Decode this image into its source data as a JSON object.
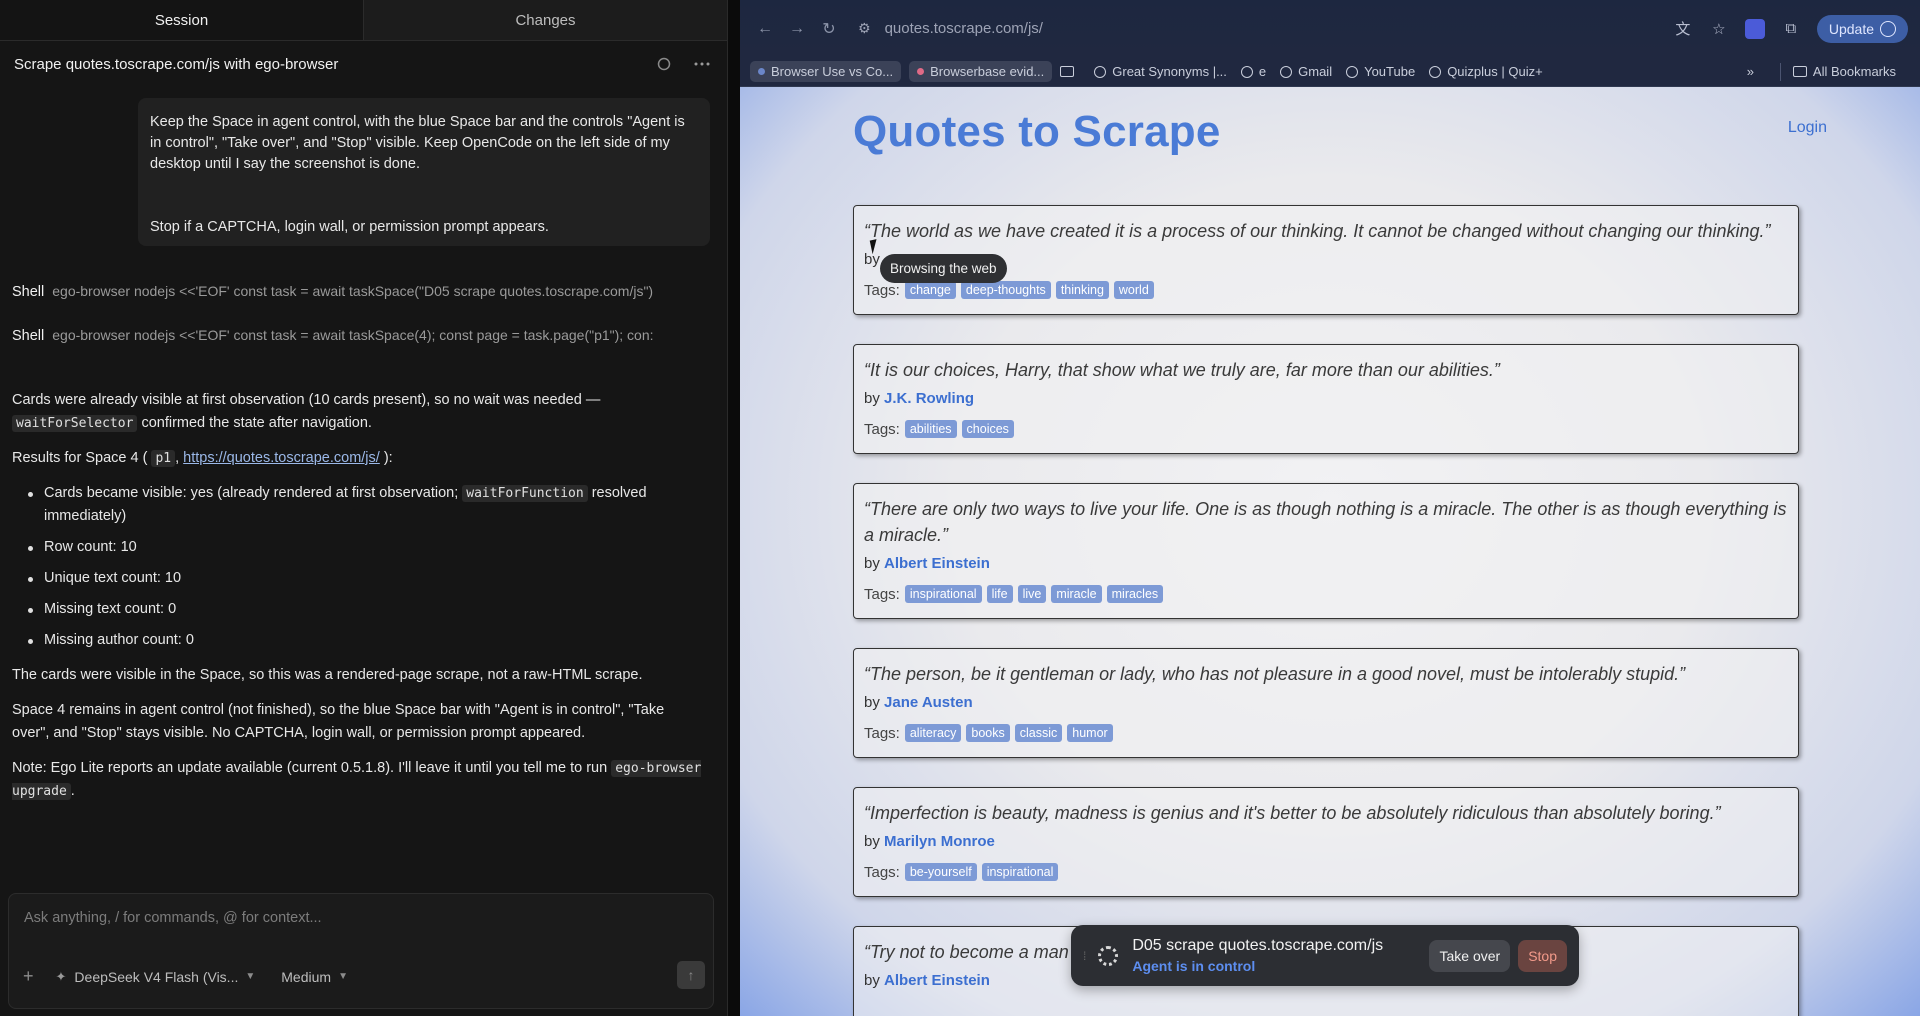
{
  "session_panel": {
    "tabs": {
      "session": "Session",
      "changes": "Changes"
    },
    "session_title": "Scrape quotes.toscrape.com/js with ego-browser",
    "user_message": {
      "paragraph1": "Keep the Space in agent control, with the blue Space bar and the controls \"Agent is in control\", \"Take over\", and \"Stop\" visible. Keep OpenCode on the left side of my desktop until I say the screenshot is done.",
      "paragraph2": "Stop if a CAPTCHA, login wall, or permission prompt appears."
    },
    "shell_calls": [
      {
        "label": "Shell",
        "command": "ego-browser nodejs <<'EOF' const task = await taskSpace(\"D05 scrape quotes.toscrape.com/js\")"
      },
      {
        "label": "Shell",
        "command": "ego-browser nodejs <<'EOF' const task = await taskSpace(4); const page = task.page(\"p1\"); con:"
      }
    ],
    "response": {
      "p1_a": "Cards were already visible at first observation (10 cards present), so no wait was needed —",
      "p1_code": "waitForSelector",
      "p1_b": "confirmed the state after navigation.",
      "p2_a": "Results for Space 4 (",
      "p2_code": "p1",
      "p2_sep": ",",
      "p2_link": "https://quotes.toscrape.com/js/",
      "p2_b": "):",
      "bullet1_a": "Cards became visible: yes (already rendered at first observation;",
      "bullet1_code": "waitForFunction",
      "bullet1_b": "resolved immediately)",
      "bullet2": "Row count: 10",
      "bullet3": "Unique text count: 10",
      "bullet4": "Missing text count: 0",
      "bullet5": "Missing author count: 0",
      "p3": "The cards were visible in the Space, so this was a rendered-page scrape, not a raw-HTML scrape.",
      "p4": "Space 4 remains in agent control (not finished), so the blue Space bar with \"Agent is in control\", \"Take over\", and \"Stop\" stays visible. No CAPTCHA, login wall, or permission prompt appeared.",
      "p5_a": "Note: Ego Lite reports an update available (current 0.5.1.8). I'll leave it until you tell me to run",
      "p5_code": "ego-browser upgrade",
      "p5_b": "."
    },
    "composer": {
      "placeholder": "Ask anything, / for commands, @ for context...",
      "model": "DeepSeek V4 Flash (Vis...",
      "effort": "Medium"
    }
  },
  "browser": {
    "url": "quotes.toscrape.com/js/",
    "update_label": "Update",
    "bookmarks": [
      "Browser Use vs Co...",
      "Browserbase evid...",
      "Great Synonyms |...",
      "e",
      "Gmail",
      "YouTube",
      "Quizplus | Quiz+"
    ],
    "all_bookmarks": "All Bookmarks",
    "page": {
      "title": "Quotes to Scrape",
      "login": "Login",
      "by_label": "by",
      "tags_label": "Tags:",
      "quotes": [
        {
          "text": "“The world as we have created it is a process of our thinking. It cannot be changed without changing our thinking.”",
          "author": "",
          "tags": [
            "change",
            "deep-thoughts",
            "thinking",
            "world"
          ]
        },
        {
          "text": "“It is our choices, Harry, that show what we truly are, far more than our abilities.”",
          "author": "J.K. Rowling",
          "tags": [
            "abilities",
            "choices"
          ]
        },
        {
          "text": "“There are only two ways to live your life. One is as though nothing is a miracle. The other is as though everything is a miracle.”",
          "author": "Albert Einstein",
          "tags": [
            "inspirational",
            "life",
            "live",
            "miracle",
            "miracles"
          ]
        },
        {
          "text": "“The person, be it gentleman or lady, who has not pleasure in a good novel, must be intolerably stupid.”",
          "author": "Jane Austen",
          "tags": [
            "aliteracy",
            "books",
            "classic",
            "humor"
          ]
        },
        {
          "text": "“Imperfection is beauty, madness is genius and it's better to be absolutely ridiculous than absolutely boring.”",
          "author": "Marilyn Monroe",
          "tags": [
            "be-yourself",
            "inspirational"
          ]
        },
        {
          "text": "“Try not to become a man",
          "author": "Albert Einstein",
          "tags": []
        }
      ],
      "tooltip": "Browsing the web"
    },
    "space_bar": {
      "name": "D05 scrape quotes.toscrape.com/js",
      "status": "Agent is in control",
      "take_over": "Take over",
      "stop": "Stop"
    }
  }
}
